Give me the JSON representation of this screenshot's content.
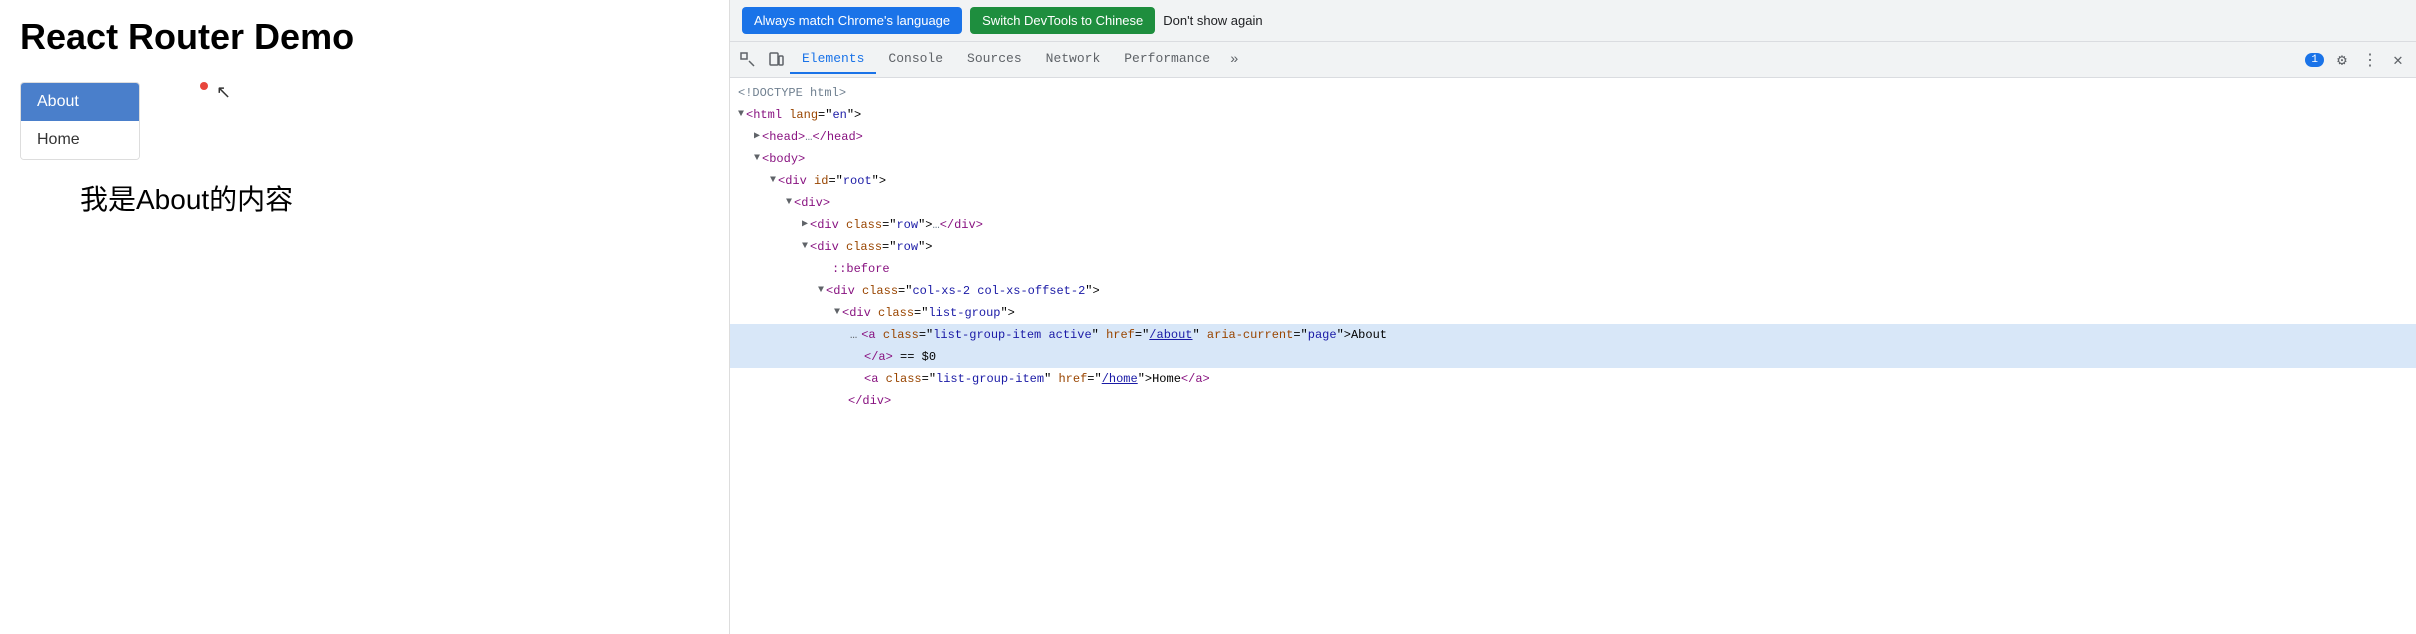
{
  "notification": {
    "btn1_label": "Always match Chrome's language",
    "btn2_label": "Switch DevTools to Chinese",
    "dismiss_label": "Don't show again"
  },
  "browser": {
    "title": "React Router Demo",
    "nav_about_label": "About",
    "nav_home_label": "Home",
    "content_text": "我是About的内容"
  },
  "devtools": {
    "tabs": [
      {
        "label": "Elements",
        "active": true
      },
      {
        "label": "Console",
        "active": false
      },
      {
        "label": "Sources",
        "active": false
      },
      {
        "label": "Network",
        "active": false
      },
      {
        "label": "Performance",
        "active": false
      }
    ],
    "badge_count": "1",
    "dom": [
      {
        "indent": 0,
        "html": "comment",
        "text": "<!DOCTYPE html>"
      },
      {
        "indent": 0,
        "html": "tag_open",
        "text": "<html lang=\"en\">"
      },
      {
        "indent": 1,
        "html": "tag_collapsed",
        "text": "<head>…</head>"
      },
      {
        "indent": 1,
        "html": "tag_open",
        "text": "<body>"
      },
      {
        "indent": 2,
        "html": "tag_open",
        "text": "<div id=\"root\">"
      },
      {
        "indent": 3,
        "html": "tag_open",
        "text": "<div>"
      },
      {
        "indent": 4,
        "html": "tag_collapsed",
        "text": "<div class=\"row\">…</div>"
      },
      {
        "indent": 4,
        "html": "tag_open",
        "text": "<div class=\"row\">"
      },
      {
        "indent": 5,
        "html": "pseudo",
        "text": "::before"
      },
      {
        "indent": 5,
        "html": "tag_open",
        "text": "<div class=\"col-xs-2 col-xs-offset-2\">"
      },
      {
        "indent": 6,
        "html": "tag_open",
        "text": "<div class=\"list-group\">"
      },
      {
        "indent": 7,
        "html": "tag_anchor_active",
        "text": "<a class=\"list-group-item active\" href=\"/about\" aria-current=\"page\">About"
      },
      {
        "indent": 7,
        "html": "tag_dollar",
        "text": "</a> == $0"
      },
      {
        "indent": 7,
        "html": "tag_anchor_home",
        "text": "<a class=\"list-group-item\" href=\"/home\">Home</a>"
      },
      {
        "indent": 6,
        "html": "tag_close",
        "text": "</div>"
      }
    ]
  }
}
